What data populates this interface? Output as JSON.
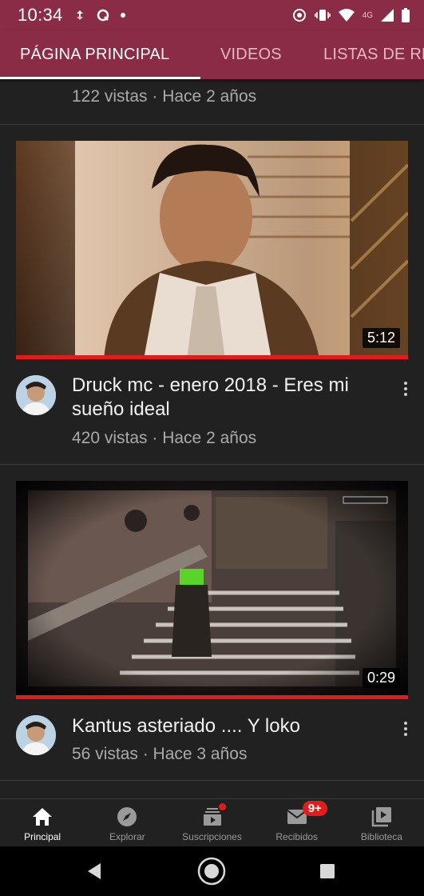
{
  "status_bar": {
    "time": "10:34",
    "network": "4G",
    "left_icons": [
      "sync-icon",
      "app-icon",
      "dot-icon"
    ],
    "right_icons": [
      "location-icon",
      "vibrate-icon",
      "wifi-icon",
      "signal-icon",
      "battery-icon"
    ]
  },
  "tabs": [
    {
      "label": "PÁGINA PRINCIPAL",
      "active": true
    },
    {
      "label": "VIDEOS",
      "active": false
    },
    {
      "label": "LISTAS DE REPRODUCCIÓN",
      "active": false
    }
  ],
  "feed": {
    "previous_item_meta": "122 vistas · Hace 2 años",
    "videos": [
      {
        "title": "Druck mc - enero 2018 - Eres mi sueño ideal",
        "meta": "420 vistas · Hace 2 años",
        "duration": "5:12",
        "watched_fraction": 1.0
      },
      {
        "title": "Kantus asteriado .... Y loko",
        "meta": "56 vistas · Hace 3 años",
        "duration": "0:29",
        "watched_fraction": 1.0
      }
    ]
  },
  "bottom_nav": {
    "items": [
      {
        "label": "Principal",
        "icon": "home-icon",
        "active": true
      },
      {
        "label": "Explorar",
        "icon": "compass-icon",
        "active": false
      },
      {
        "label": "Suscripciones",
        "icon": "subscriptions-icon",
        "active": false
      },
      {
        "label": "Recibidos",
        "icon": "mail-icon",
        "active": false,
        "badge": "9+"
      },
      {
        "label": "Biblioteca",
        "icon": "library-icon",
        "active": false
      }
    ]
  },
  "colors": {
    "brand": "#8a2c45",
    "background": "#212121",
    "progress": "#e21c1c",
    "secondary_text": "#aaaaaa"
  }
}
